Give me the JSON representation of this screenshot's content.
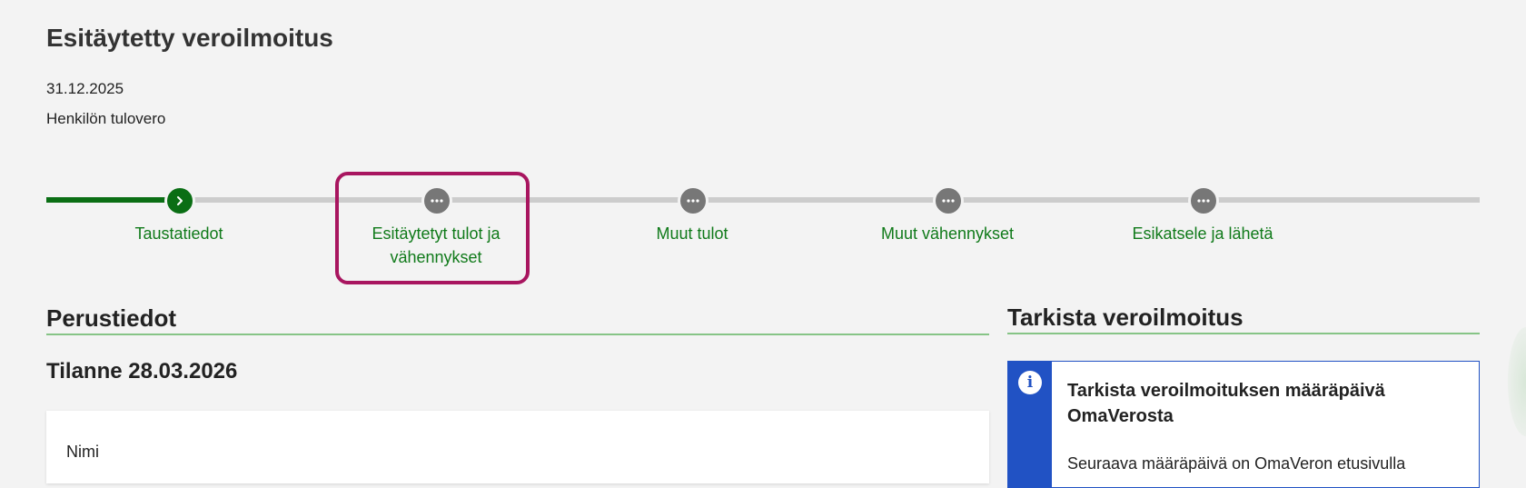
{
  "header": {
    "title": "Esitäytetty veroilmoitus",
    "date": "31.12.2025",
    "type": "Henkilön tulovero"
  },
  "stepper": {
    "steps": [
      {
        "label": "Taustatiedot",
        "status": "done",
        "icon": "chevron-right-icon"
      },
      {
        "label": "Esitäytetyt tulot ja vähennykset",
        "status": "pending",
        "icon": "more-dots-icon",
        "highlighted": true
      },
      {
        "label": "Muut tulot",
        "status": "pending",
        "icon": "more-dots-icon"
      },
      {
        "label": "Muut vähennykset",
        "status": "pending",
        "icon": "more-dots-icon"
      },
      {
        "label": "Esikatsele ja lähetä",
        "status": "pending",
        "icon": "more-dots-icon"
      }
    ],
    "colors": {
      "done": "#0a6e14",
      "pending": "#777777",
      "label": "#107a1a",
      "highlight": "#a8155f"
    }
  },
  "main": {
    "section_title": "Perustiedot",
    "situation": "Tilanne 28.03.2026",
    "card": {
      "label": "Nimi"
    }
  },
  "sidebar": {
    "section_title": "Tarkista veroilmoitus",
    "info": {
      "icon": "info-icon",
      "title": "Tarkista veroilmoituksen määräpäivä OmaVerosta",
      "text": "Seuraava määräpäivä on OmaVeron etusivulla",
      "accent": "#2152c4"
    }
  }
}
